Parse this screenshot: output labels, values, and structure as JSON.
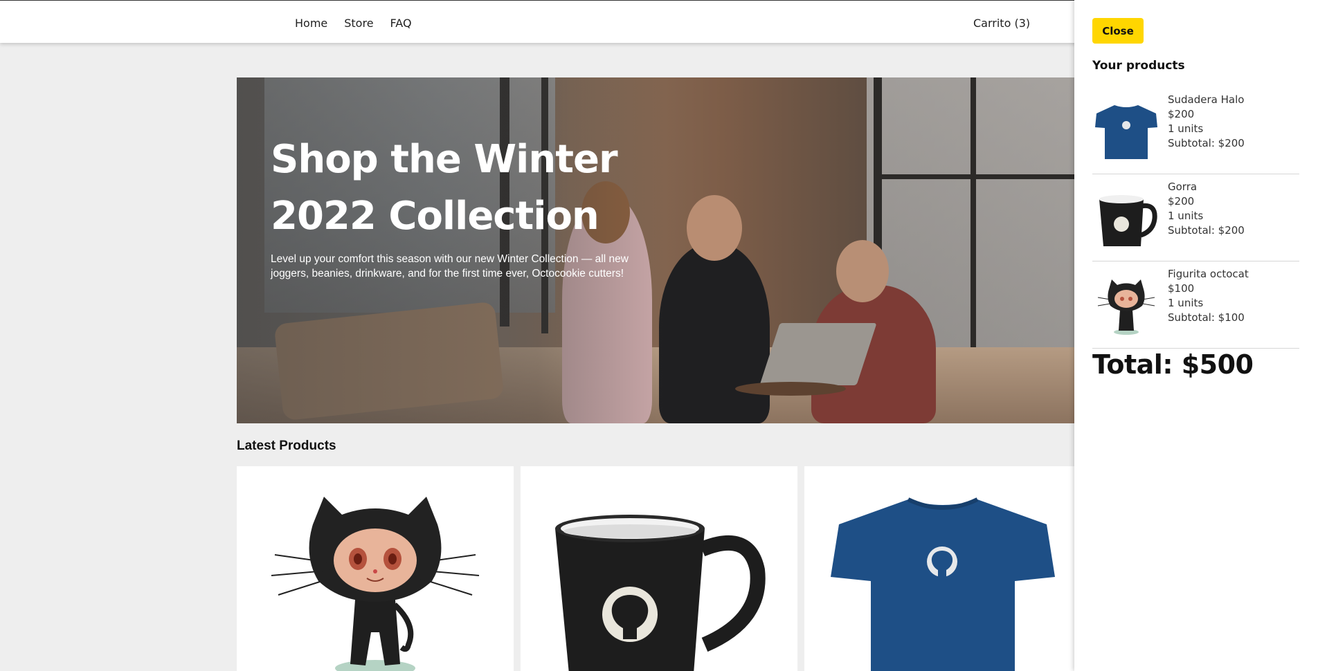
{
  "nav": {
    "links": [
      "Home",
      "Store",
      "FAQ"
    ],
    "cart_label": "Carrito (3)"
  },
  "hero": {
    "title": "Shop the Winter 2022 Collection",
    "text": "Level up your comfort this season with our new Winter Collection — all new joggers, beanies, drinkware, and for the first time ever, Octocookie cutters!"
  },
  "latest": {
    "title": "Latest Products",
    "cards": [
      {
        "icon": "octocat-figurine-icon"
      },
      {
        "icon": "github-mug-icon"
      },
      {
        "icon": "github-tshirt-icon"
      }
    ]
  },
  "drawer": {
    "close_label": "Close",
    "title": "Your products",
    "items": [
      {
        "name": "Sudadera Halo",
        "price": "$200",
        "units": "1 units",
        "subtotal": "Subtotal: $200",
        "icon": "tshirt-icon"
      },
      {
        "name": "Gorra",
        "price": "$200",
        "units": "1 units",
        "subtotal": "Subtotal: $200",
        "icon": "mug-icon"
      },
      {
        "name": "Figurita octocat",
        "price": "$100",
        "units": "1 units",
        "subtotal": "Subtotal: $100",
        "icon": "octocat-icon"
      }
    ],
    "total": "Total: $500"
  },
  "colors": {
    "accent": "#ffd600",
    "page_background": "#eeeeee",
    "tshirt_blue": "#1e4f86",
    "mug_black": "#1d1d1d"
  }
}
